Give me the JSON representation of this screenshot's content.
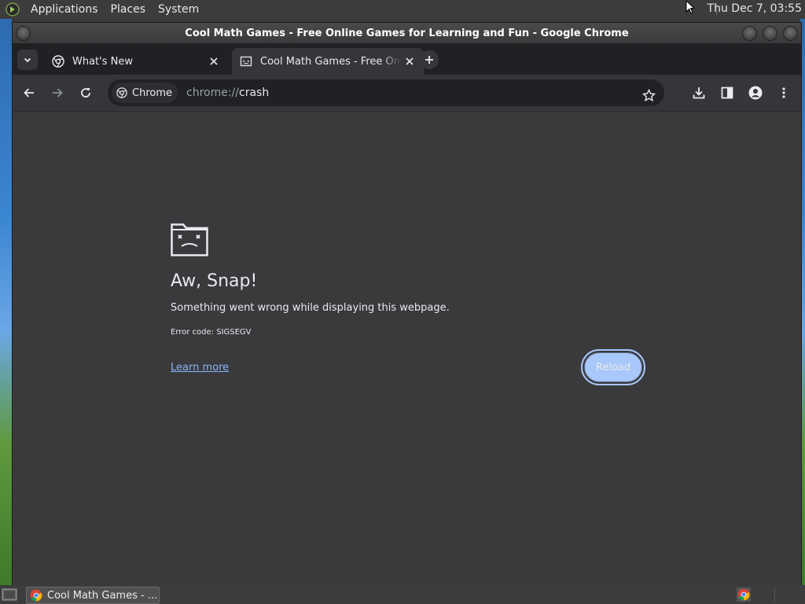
{
  "top_panel": {
    "menus": [
      "Applications",
      "Places",
      "System"
    ],
    "clock": "Thu Dec  7, 03:55"
  },
  "window": {
    "title": "Cool Math Games - Free Online Games for Learning and Fun - Google Chrome"
  },
  "tabs": [
    {
      "title": "What's New",
      "active": false,
      "icon": "chrome-icon"
    },
    {
      "title": "Cool Math Games - Free Online Games for Learning and Fun",
      "active": true,
      "icon": "sad-tab-icon"
    }
  ],
  "toolbar": {
    "chip_label": "Chrome",
    "url_scheme": "chrome://",
    "url_host": "crash"
  },
  "error_page": {
    "heading": "Aw, Snap!",
    "message": "Something went wrong while displaying this webpage.",
    "error_code": "Error code: SIGSEGV",
    "learn_more": "Learn more",
    "reload": "Reload"
  },
  "taskbar": {
    "task_label": "Cool Math Games - ..."
  },
  "colors": {
    "page_bg": "#3a3a3c",
    "link": "#8ab4f8",
    "reload_bg": "#a8c7fa"
  }
}
